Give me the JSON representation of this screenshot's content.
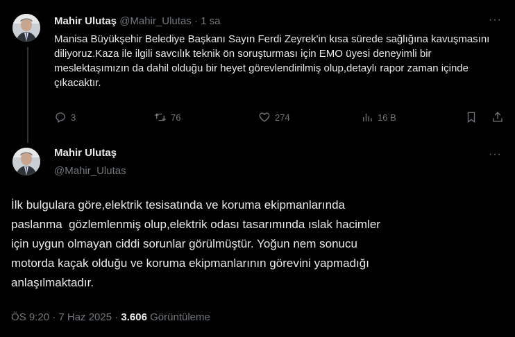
{
  "reply_tweet": {
    "author_name": "Mahir Ulutaş",
    "handle": "@Mahir_Ulutas",
    "separator": "·",
    "time": "1 sa",
    "text": "Manisa Büyükşehir Belediye Başkanı Sayın Ferdi Zeyrek'in kısa sürede sağlığına kavuşmasını diliyoruz.Kaza ile ilgili savcılık teknik ön soruşturması için EMO üyesi deneyimli bir meslektaşımızın da dahil olduğu bir heyet görevlendirilmiş olup,detaylı rapor zaman içinde çıkacaktır.",
    "more_label": "···",
    "replies": "3",
    "reposts": "76",
    "likes": "274",
    "views": "16 B"
  },
  "main_tweet": {
    "author_name": "Mahir Ulutaş",
    "handle": "@Mahir_Ulutas",
    "more_label": "···",
    "text_lines": [
      "İlk bulgulara göre,elektrik tesisatında ve koruma ekipmanlarında",
      "paslanma  gözlemlenmiş olup,elektrik odası tasarımında ıslak hacimler",
      "için uygun olmayan ciddi sorunlar görülmüştür. Yoğun nem sonucu",
      "motorda kaçak olduğu ve koruma ekipmanlarının görevini yapmadığı",
      "anlaşılmaktadır."
    ],
    "timestamp": "ÖS 9:20 · 7 Haz 2025 · ",
    "view_count": "3.606",
    "view_label": " Görüntüleme"
  },
  "icons": [
    "reply-icon",
    "repost-icon",
    "like-icon",
    "views-icon",
    "bookmark-icon",
    "share-icon",
    "more-icon"
  ],
  "colors": {
    "background": "#000000",
    "text": "#e7e9ea",
    "muted": "#71767b",
    "thread_line": "#333639"
  }
}
